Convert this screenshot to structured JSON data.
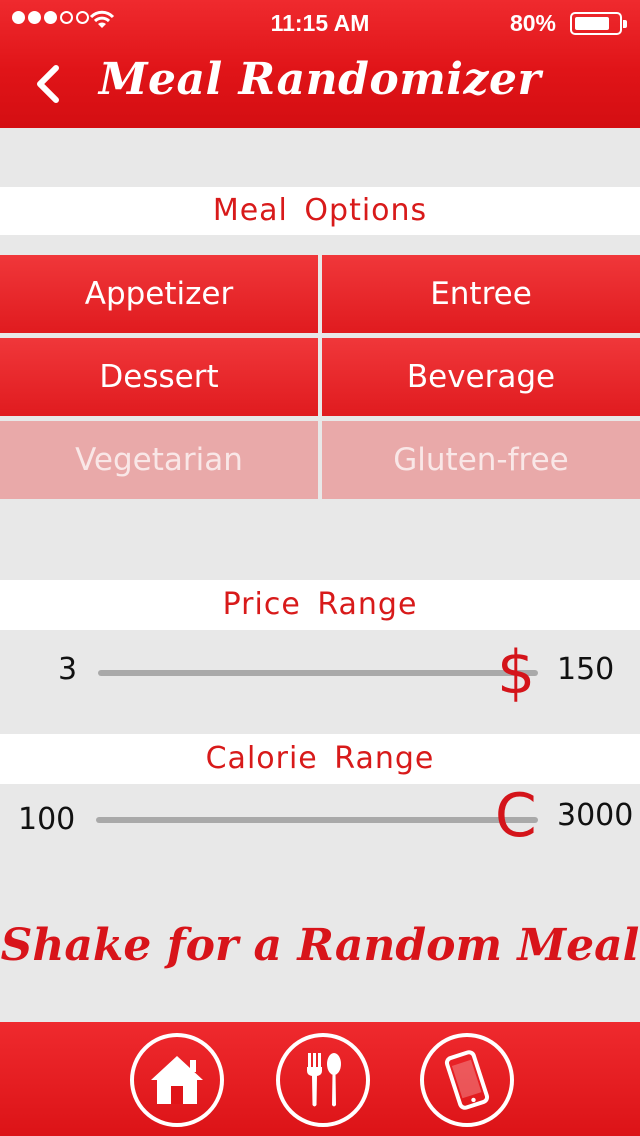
{
  "status_bar": {
    "time": "11:15 AM",
    "battery_percent": "80%",
    "battery_level": 0.8,
    "signal_bars_filled": 3,
    "signal_bars_total": 5
  },
  "nav": {
    "title": "Meal Randomizer",
    "back_icon": "chevron-left-icon"
  },
  "meal_options": {
    "label": "Meal Options",
    "buttons": [
      {
        "label": "Appetizer",
        "enabled": true
      },
      {
        "label": "Entree",
        "enabled": true
      },
      {
        "label": "Dessert",
        "enabled": true
      },
      {
        "label": "Beverage",
        "enabled": true
      },
      {
        "label": "Vegetarian",
        "enabled": false
      },
      {
        "label": "Gluten-free",
        "enabled": false
      }
    ]
  },
  "price_range": {
    "label": "Price Range",
    "min": "3",
    "max": "150",
    "thumb_symbol": "$",
    "value_fraction": 0.95
  },
  "calorie_range": {
    "label": "Calorie Range",
    "min": "100",
    "max": "3000",
    "thumb_symbol": "C",
    "value_fraction": 0.95
  },
  "shake_text": "Shake for a Random Meal",
  "tab_bar": {
    "items": [
      {
        "icon": "home-icon"
      },
      {
        "icon": "fork-spoon-icon"
      },
      {
        "icon": "phone-icon"
      }
    ]
  },
  "colors": {
    "brand_red": "#e01418",
    "disabled_pink": "#e9a9a9",
    "background_gray": "#e8e8e8"
  }
}
